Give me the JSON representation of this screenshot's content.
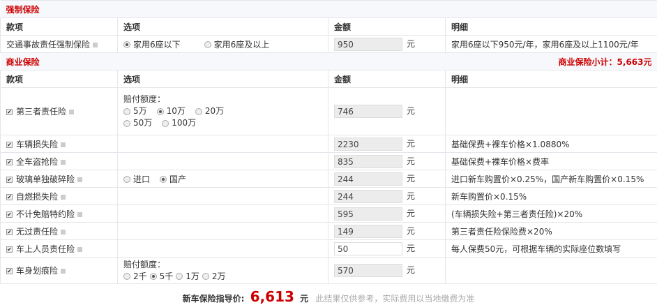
{
  "compulsory": {
    "title": "强制保险",
    "headers": [
      "款项",
      "选项",
      "金额",
      "明细"
    ],
    "row": {
      "name": "交通事故责任强制保险",
      "options": [
        "家用6座以下",
        "家用6座及以上"
      ],
      "amount": "950",
      "unit": "元",
      "detail": "家用6座以下950元/年，家用6座及以上1100元/年"
    }
  },
  "commercial": {
    "title": "商业保险",
    "subtotal": "商业保险小计：5,663元",
    "headers": [
      "款项",
      "选项",
      "金额",
      "明细"
    ],
    "payout_label": "赔付额度：",
    "rows": [
      {
        "name": "第三者责任险",
        "options": [
          "5万",
          "10万",
          "20万",
          "50万",
          "100万"
        ],
        "amount": "746",
        "unit": "元",
        "detail": ""
      },
      {
        "name": "车辆损失险",
        "amount": "2230",
        "unit": "元",
        "detail": "基础保费+裸车价格×1.0880%"
      },
      {
        "name": "全车盗抢险",
        "amount": "835",
        "unit": "元",
        "detail": "基础保费+裸车价格×费率"
      },
      {
        "name": "玻璃单独破碎险",
        "options": [
          "进口",
          "国产"
        ],
        "amount": "244",
        "unit": "元",
        "detail": "进口新车购置价×0.25%，国产新车购置价×0.15%"
      },
      {
        "name": "自燃损失险",
        "amount": "244",
        "unit": "元",
        "detail": "新车购置价×0.15%"
      },
      {
        "name": "不计免赔特约险",
        "amount": "595",
        "unit": "元",
        "detail": "(车辆损失险+第三者责任险)×20%"
      },
      {
        "name": "无过责任险",
        "amount": "149",
        "unit": "元",
        "detail": "第三者责任险保险费×20%"
      },
      {
        "name": "车上人员责任险",
        "amount": "50",
        "unit": "元",
        "detail": "每人保费50元，可根据车辆的实际座位数填写"
      },
      {
        "name": "车身划痕险",
        "options": [
          "2千",
          "5千",
          "1万",
          "2万"
        ],
        "amount": "570",
        "unit": "元",
        "detail": ""
      }
    ]
  },
  "footer": {
    "label": "新车保险指导价:",
    "total": "6,613",
    "unit": "元",
    "note": "此结果仅供参考，实际费用以当地缴费为准"
  }
}
